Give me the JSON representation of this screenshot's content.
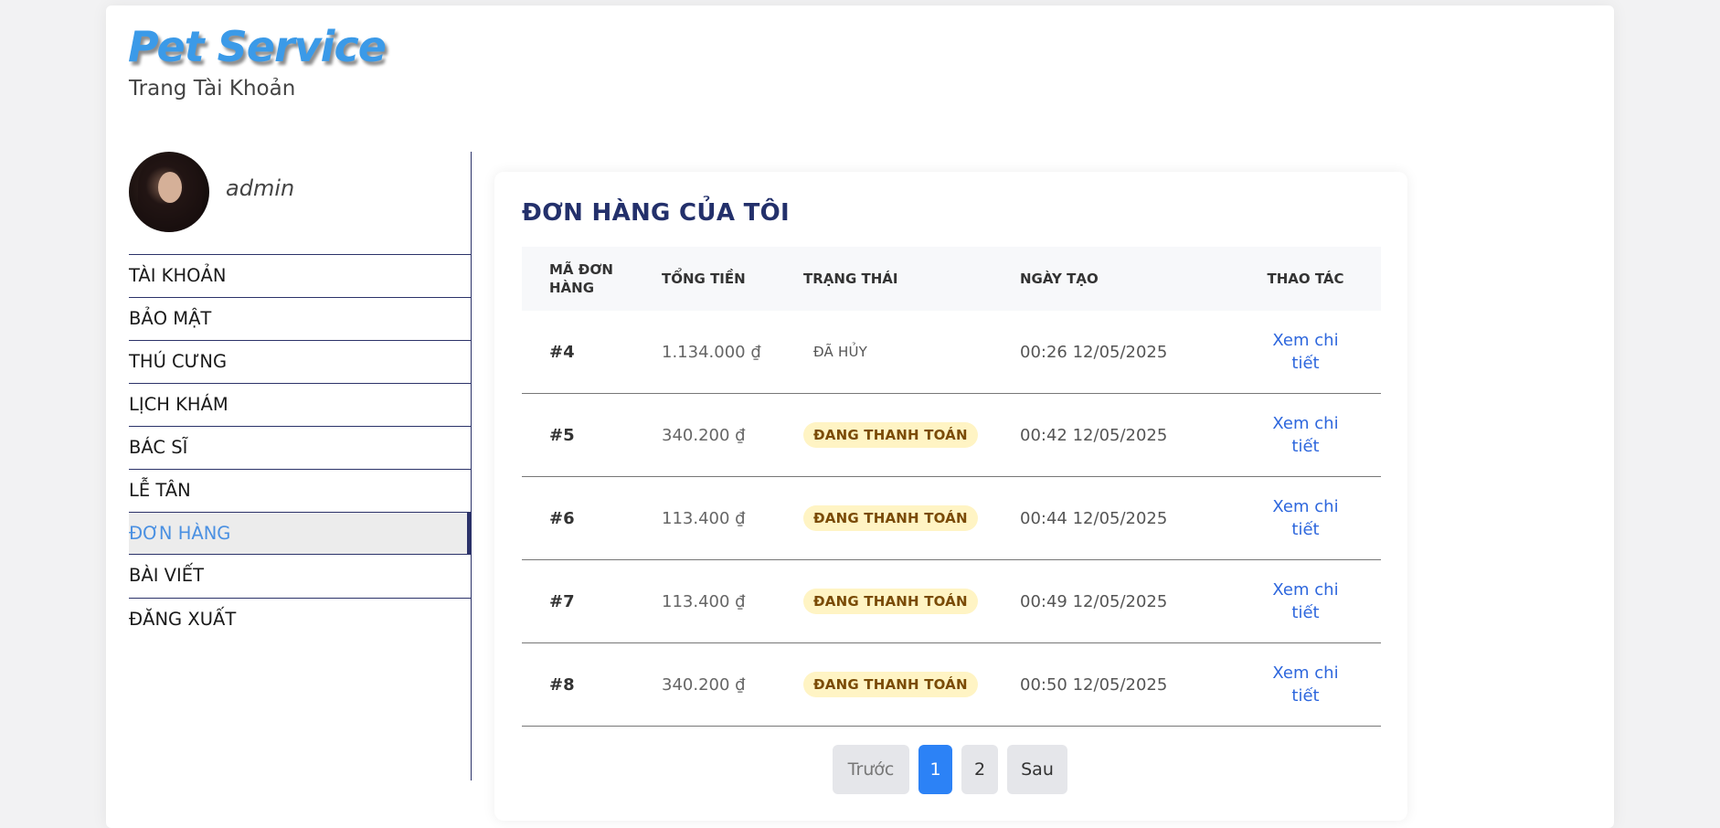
{
  "header": {
    "brand": "Pet Service",
    "subtitle": "Trang Tài Khoản"
  },
  "profile": {
    "username": "admin"
  },
  "sidebar": {
    "items": [
      {
        "label": "TÀI KHOẢN"
      },
      {
        "label": "BẢO MẬT"
      },
      {
        "label": "THÚ CƯNG"
      },
      {
        "label": "LỊCH KHÁM"
      },
      {
        "label": "BÁC SĨ"
      },
      {
        "label": "LỄ TÂN"
      },
      {
        "label": "ĐƠN HÀNG"
      },
      {
        "label": "BÀI VIẾT"
      },
      {
        "label": "ĐĂNG XUẤT"
      }
    ],
    "active_index": 6
  },
  "main": {
    "title": "ĐƠN HÀNG CỦA TÔI",
    "table": {
      "columns": [
        "MÃ ĐƠN HÀNG",
        "TỔNG TIỀN",
        "TRẠNG THÁI",
        "NGÀY TẠO",
        "THAO TÁC"
      ],
      "rows": [
        {
          "id": "#4",
          "total": "1.134.000 ₫",
          "status": "ĐÃ HỦY",
          "created": "00:26 12/05/2025",
          "action": "Xem chi tiết"
        },
        {
          "id": "#5",
          "total": "340.200 ₫",
          "status": "ĐANG THANH TOÁN",
          "created": "00:42 12/05/2025",
          "action": "Xem chi tiết"
        },
        {
          "id": "#6",
          "total": "113.400 ₫",
          "status": "ĐANG THANH TOÁN",
          "created": "00:44 12/05/2025",
          "action": "Xem chi tiết"
        },
        {
          "id": "#7",
          "total": "113.400 ₫",
          "status": "ĐANG THANH TOÁN",
          "created": "00:49 12/05/2025",
          "action": "Xem chi tiết"
        },
        {
          "id": "#8",
          "total": "340.200 ₫",
          "status": "ĐANG THANH TOÁN",
          "created": "00:50 12/05/2025",
          "action": "Xem chi tiết"
        }
      ]
    },
    "pagination": {
      "prev": "Trước",
      "pages": [
        "1",
        "2"
      ],
      "current": "1",
      "next": "Sau"
    }
  },
  "colors": {
    "brand": "#3b9ae8",
    "navy": "#23306b",
    "link": "#2e67dd",
    "active_page": "#2c82f6",
    "paying_badge_bg": "#fff4c4"
  }
}
